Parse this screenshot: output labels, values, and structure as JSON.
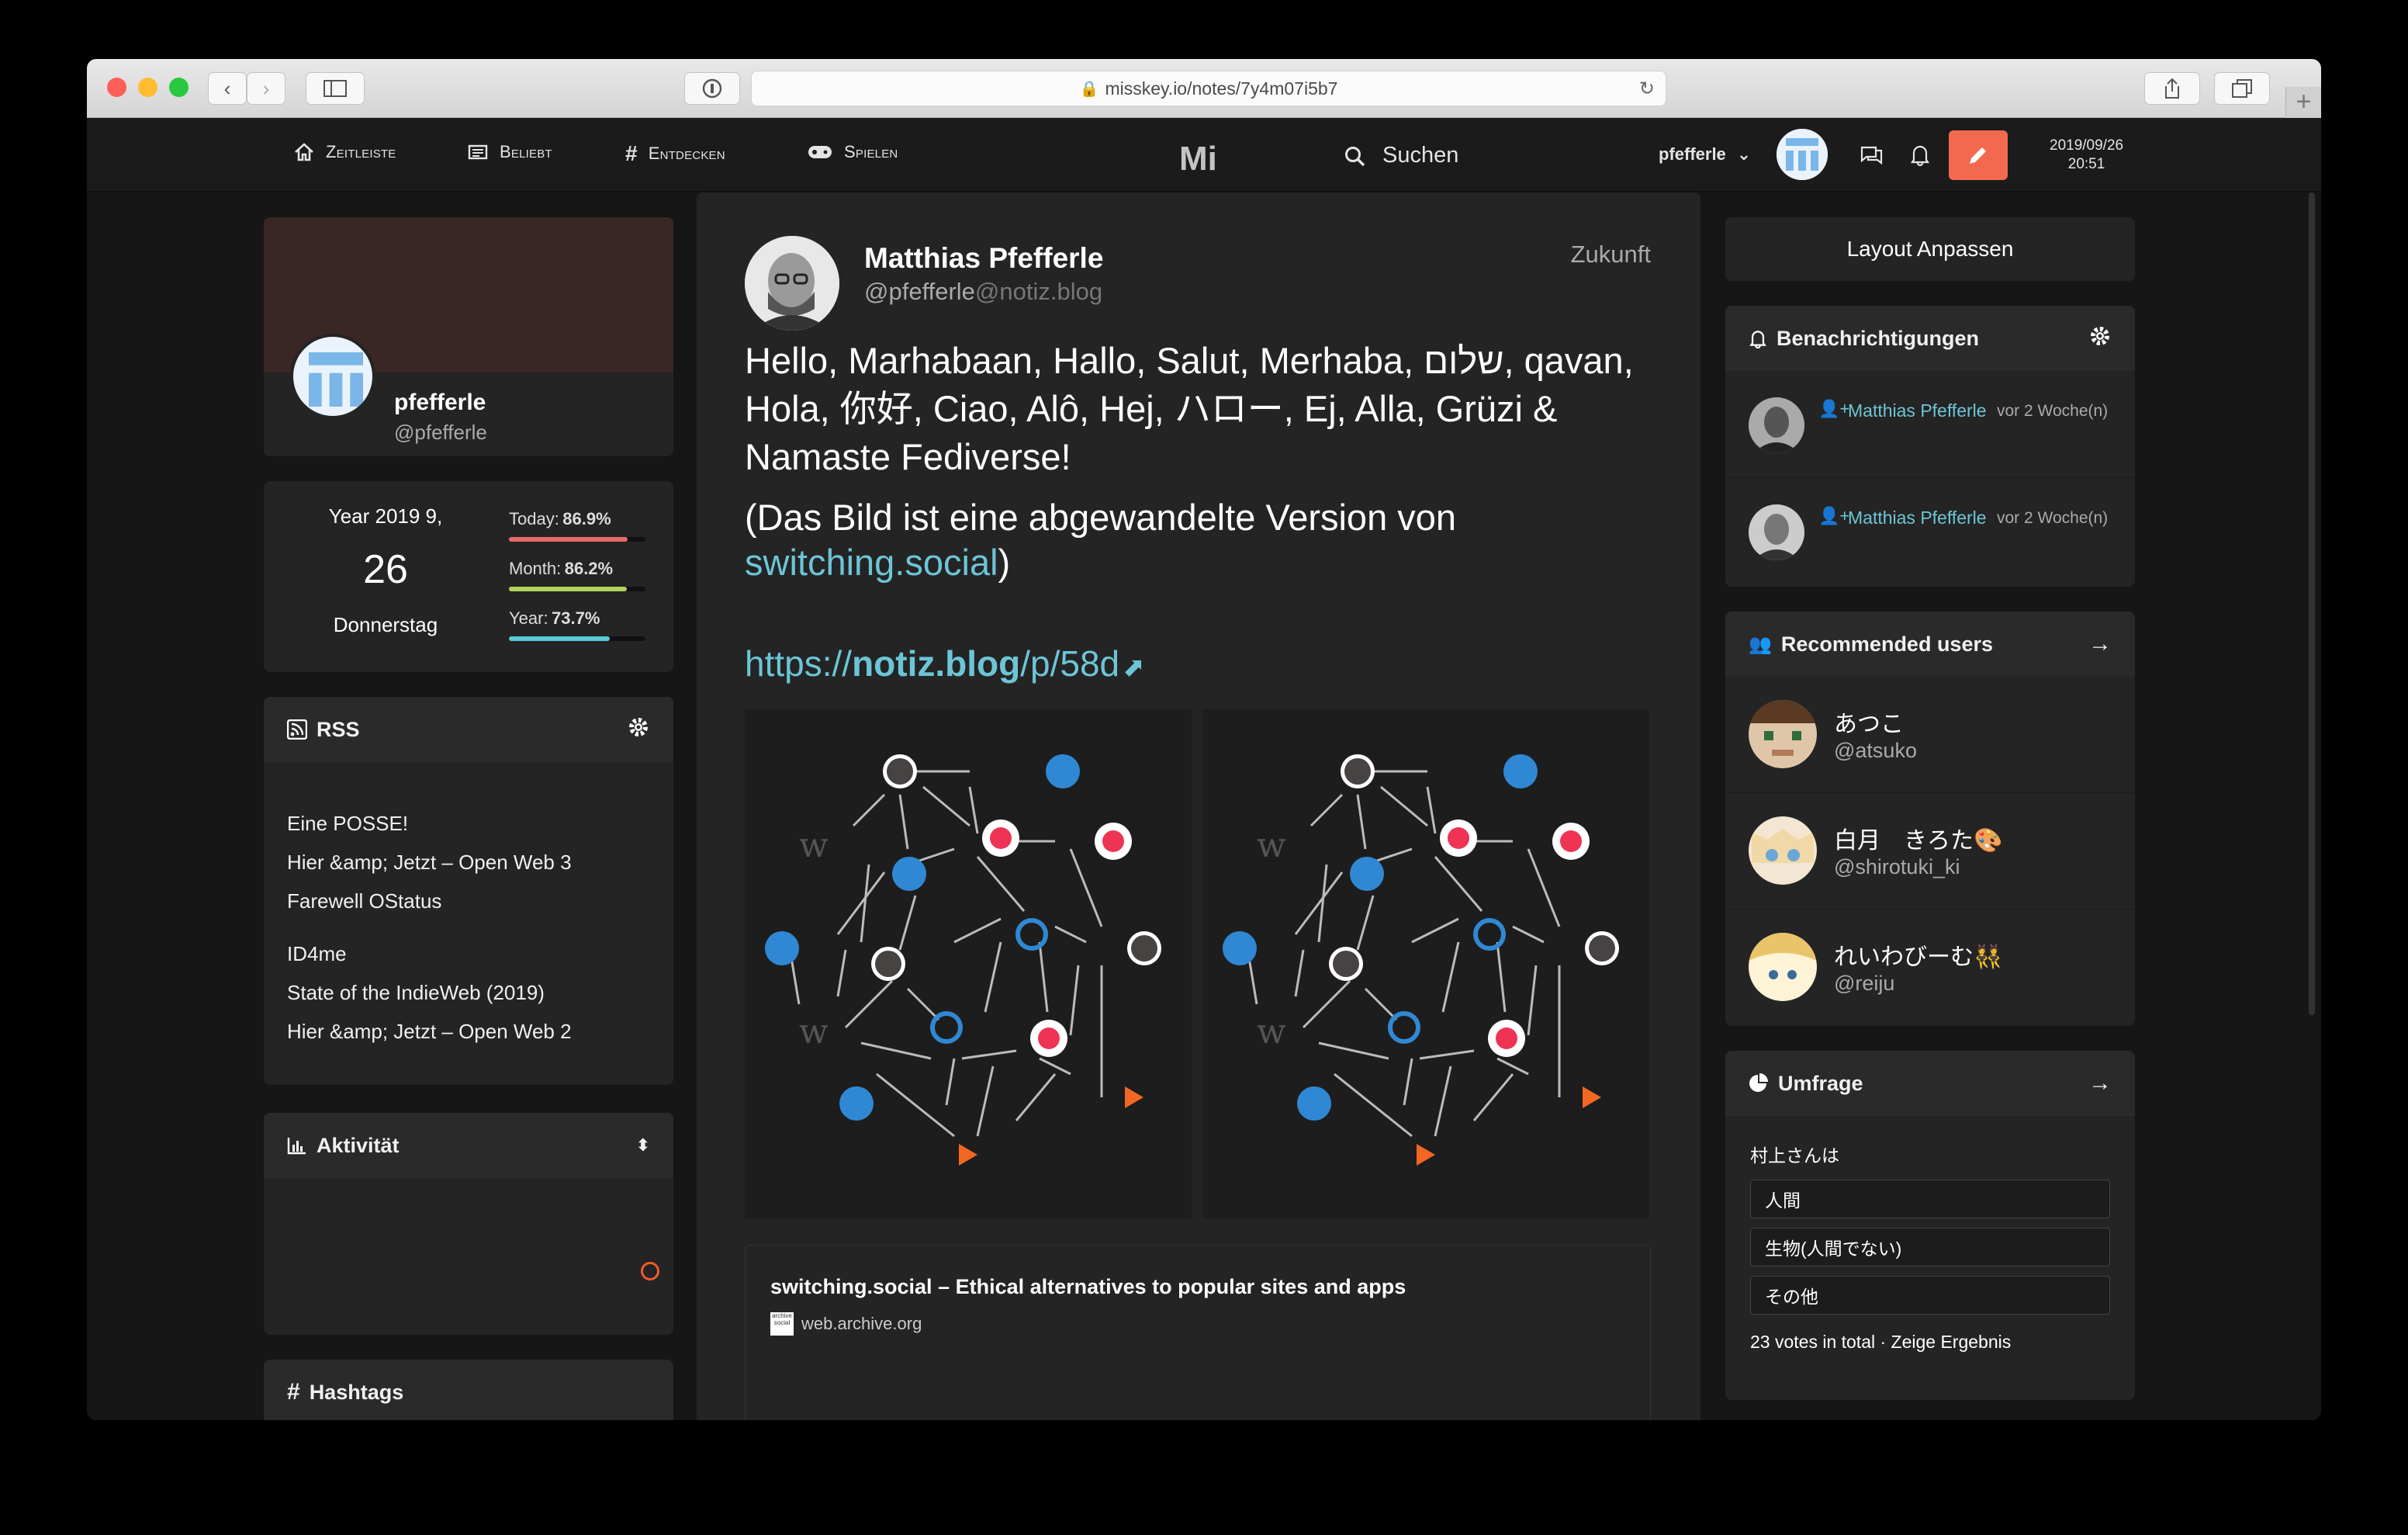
{
  "browser": {
    "url": "misskey.io/notes/7y4m07i5b7"
  },
  "nav": {
    "timeline": "Zeitleiste",
    "popular": "Beliebt",
    "explore": "Entdecken",
    "games": "Spielen",
    "search": "Suchen",
    "user": "pfefferle",
    "date": "2019/09/26",
    "time": "20:51"
  },
  "profile": {
    "name": "pfefferle",
    "handle": "@pfefferle"
  },
  "calendar": {
    "ym": "Year 2019  9,",
    "day": "26",
    "weekday": "Donnerstag",
    "today_label": "Today:",
    "today": "86.9%",
    "month_label": "Month:",
    "month": "86.2%",
    "year_label": "Year:",
    "year": "73.7%",
    "today_frac": 0.869,
    "month_frac": 0.862,
    "year_frac": 0.737,
    "colors": {
      "today": "#e86a6a",
      "month": "#b3d45a",
      "year": "#5ac9d4"
    }
  },
  "rss": {
    "title": "RSS",
    "items": [
      "Eine POSSE!",
      "Hier &amp; Jetzt – Open Web 3",
      "Farewell OStatus",
      "ID4me",
      "State of the IndieWeb (2019)",
      "Hier &amp; Jetzt – Open Web 2"
    ]
  },
  "activity": {
    "title": "Aktivität"
  },
  "hashtags": {
    "title": "Hashtags"
  },
  "note": {
    "author": "Matthias Pfefferle",
    "handle": "@pfefferle",
    "host": "@notiz.blog",
    "time": "Zukunft",
    "text": "Hello, Marhabaan, Hallo, Salut, Merhaba, שלום, qavan, Hola, 你好, Ciao, Alô, Hej, ハロー, Ej, Alla, Grüzi & Namaste Fediverse!",
    "paren_open": "(Das Bild ist eine abgewandelte Version von ",
    "paren_link": "switching.social",
    "paren_close": ")",
    "link_pre": "https://",
    "link_host": "notiz.blog",
    "link_path": "/p/58d",
    "preview_title": "switching.social – Ethical alternatives to popular sites and apps",
    "preview_site": "web.archive.org",
    "preview_favicon_text": "archive social"
  },
  "right": {
    "layout_btn": "Layout Anpassen",
    "notif_title": "Benachrichtigungen",
    "notifs": [
      {
        "user": "Matthias Pfefferle",
        "time": "vor 2 Woche(n)"
      },
      {
        "user": "Matthias Pfefferle",
        "time": "vor 2 Woche(n)"
      }
    ],
    "rec_title": "Recommended users",
    "rec": [
      {
        "name": "あつこ",
        "handle": "@atsuko"
      },
      {
        "name": "白月　きろた🎨",
        "handle": "@shirotuki_ki"
      },
      {
        "name": "れいわびーむ👯",
        "handle": "@reiju"
      }
    ],
    "poll_title": "Umfrage",
    "poll_q": "村上さんは",
    "poll_opts": [
      "人間",
      "生物(人間でない)",
      "その他"
    ],
    "poll_foot": "23 votes in total · Zeige Ergebnis"
  }
}
